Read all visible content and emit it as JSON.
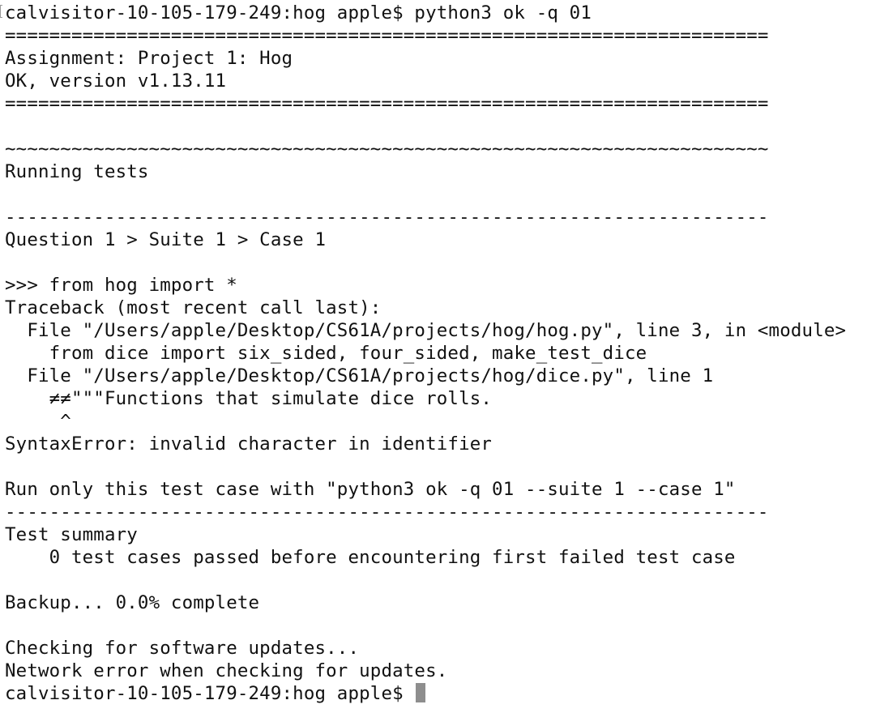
{
  "terminal": {
    "lines": [
      "calvisitor-10-105-179-249:hog apple$ python3 ok -q 01",
      "=====================================================================",
      "Assignment: Project 1: Hog",
      "OK, version v1.13.11",
      "=====================================================================",
      "",
      "~~~~~~~~~~~~~~~~~~~~~~~~~~~~~~~~~~~~~~~~~~~~~~~~~~~~~~~~~~~~~~~~~~~~~",
      "Running tests",
      "",
      "---------------------------------------------------------------------",
      "Question 1 > Suite 1 > Case 1",
      "",
      ">>> from hog import *",
      "Traceback (most recent call last):",
      "  File \"/Users/apple/Desktop/CS61A/projects/hog/hog.py\", line 3, in <module>",
      "    from dice import six_sided, four_sided, make_test_dice",
      "  File \"/Users/apple/Desktop/CS61A/projects/hog/dice.py\", line 1",
      "    ≠≠\"\"\"Functions that simulate dice rolls.",
      "     ^",
      "SyntaxError: invalid character in identifier",
      "",
      "Run only this test case with \"python3 ok -q 01 --suite 1 --case 1\"",
      "---------------------------------------------------------------------",
      "Test summary",
      "    0 test cases passed before encountering first failed test case",
      "",
      "Backup... 0.0% complete",
      "",
      "Checking for software updates...",
      "Network error when checking for updates."
    ],
    "prompt": "calvisitor-10-105-179-249:hog apple$ "
  }
}
